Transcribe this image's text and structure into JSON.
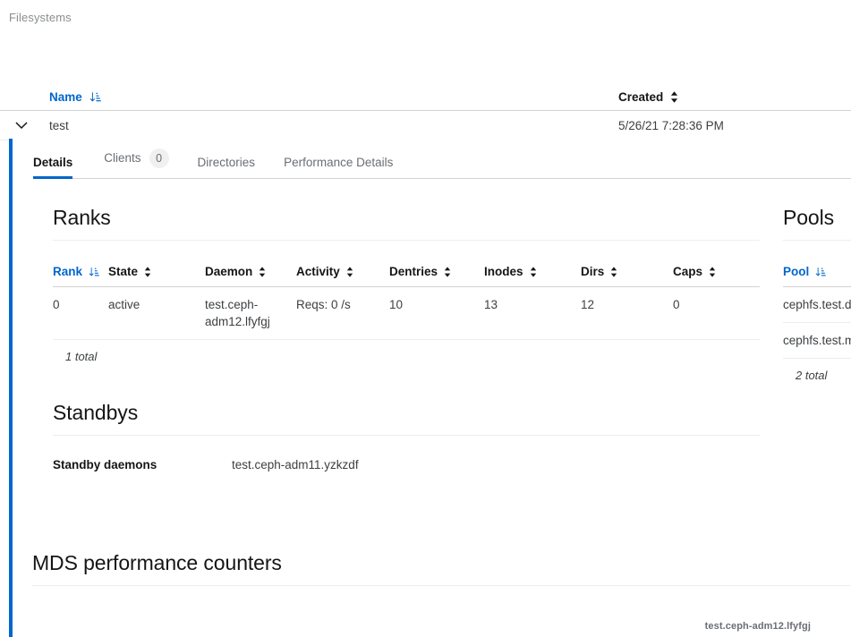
{
  "breadcrumb": "Filesystems",
  "colors": {
    "accent": "#0066cc",
    "text": "#151515",
    "muted": "#6a6e73",
    "border": "#d2d2d2"
  },
  "filesystems_table": {
    "columns": [
      {
        "label": "Name",
        "icon": "sort-amount-down-icon",
        "sorted": true
      },
      {
        "label": "Created",
        "icon": "sort-icon",
        "sorted": false
      }
    ],
    "rows": [
      {
        "expander": "chevron-down-icon",
        "name": "test",
        "created": "5/26/21 7:28:36 PM"
      }
    ]
  },
  "tabs": [
    {
      "label": "Details",
      "badge": null,
      "active": true
    },
    {
      "label": "Clients",
      "badge": "0",
      "active": false
    },
    {
      "label": "Directories",
      "badge": null,
      "active": false
    },
    {
      "label": "Performance Details",
      "badge": null,
      "active": false
    }
  ],
  "ranks": {
    "title": "Ranks",
    "columns": [
      {
        "label": "Rank",
        "icon": "sort-amount-down-icon",
        "sorted": true
      },
      {
        "label": "State",
        "icon": "sort-icon",
        "sorted": false
      },
      {
        "label": "Daemon",
        "icon": "sort-icon",
        "sorted": false
      },
      {
        "label": "Activity",
        "icon": "sort-icon",
        "sorted": false
      },
      {
        "label": "Dentries",
        "icon": "sort-icon",
        "sorted": false
      },
      {
        "label": "Inodes",
        "icon": "sort-icon",
        "sorted": false
      },
      {
        "label": "Dirs",
        "icon": "sort-icon",
        "sorted": false
      },
      {
        "label": "Caps",
        "icon": "sort-icon",
        "sorted": false
      }
    ],
    "rows": [
      {
        "rank": "0",
        "state": "active",
        "daemon": "test.ceph-adm12.lfyfgj",
        "activity": "Reqs: 0 /s",
        "dentries": "10",
        "inodes": "13",
        "dirs": "12",
        "caps": "0"
      }
    ],
    "total": "1 total"
  },
  "pools": {
    "title": "Pools",
    "columns": [
      {
        "label": "Pool",
        "icon": "sort-amount-down-icon",
        "sorted": true
      }
    ],
    "rows": [
      {
        "pool": "cephfs.test.data"
      },
      {
        "pool": "cephfs.test.meta"
      }
    ],
    "total": "2 total"
  },
  "standbys": {
    "title": "Standbys",
    "label": "Standby daemons",
    "value": "test.ceph-adm11.yzkzdf"
  },
  "mds_performance": {
    "title": "MDS performance counters",
    "daemon_label": "test.ceph-adm12.lfyfgj"
  }
}
